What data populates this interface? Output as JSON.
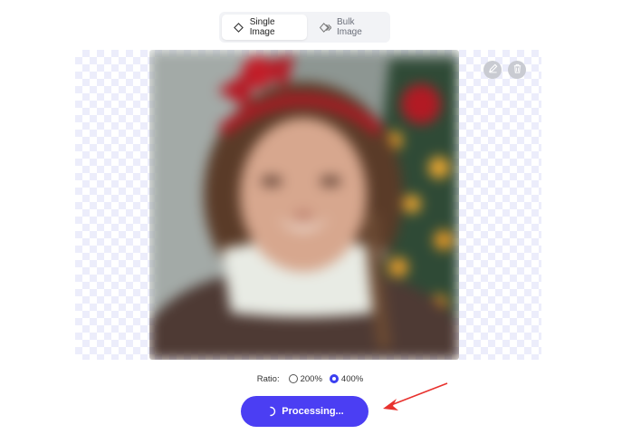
{
  "tabs": [
    {
      "label": "Single Image",
      "icon": "diamond-icon",
      "active": true
    },
    {
      "label": "Bulk Image",
      "icon": "layers-icon",
      "active": false
    }
  ],
  "image_tools": [
    {
      "icon": "pencil-icon"
    },
    {
      "icon": "trash-icon"
    }
  ],
  "ratio": {
    "label": "Ratio:",
    "options": [
      {
        "label": "200%",
        "selected": false
      },
      {
        "label": "400%",
        "selected": true
      }
    ]
  },
  "action_button": {
    "label": "Processing..."
  },
  "colors": {
    "accent": "#4b3ef3",
    "annotation_arrow": "#e8322e"
  }
}
